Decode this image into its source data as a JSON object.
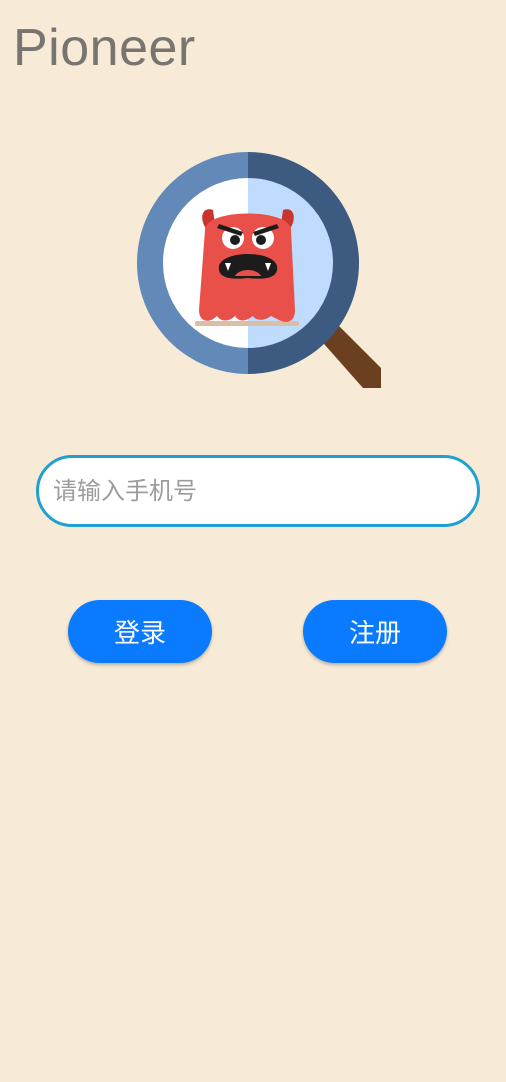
{
  "app": {
    "title": "Pioneer"
  },
  "logo": {
    "icon": "magnifier-monster-icon"
  },
  "form": {
    "phone_placeholder": "请输入手机号",
    "phone_value": ""
  },
  "actions": {
    "login_label": "登录",
    "register_label": "注册"
  },
  "colors": {
    "background": "#f7ead6",
    "accent": "#0a7bff",
    "input_border": "#1fa0d0"
  }
}
